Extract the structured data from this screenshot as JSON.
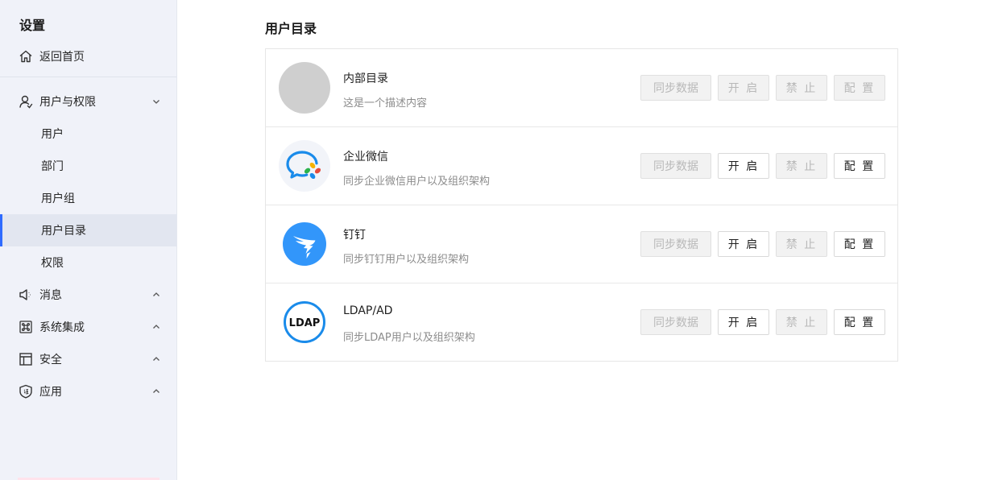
{
  "sidebar": {
    "title": "设置",
    "home": {
      "label": "返回首页",
      "icon": "home-icon"
    },
    "groups": [
      {
        "label": "用户与权限",
        "icon": "user-icon",
        "chevron": "chevron-down-icon",
        "children": [
          {
            "label": "用户"
          },
          {
            "label": "部门"
          },
          {
            "label": "用户组"
          },
          {
            "label": "用户目录",
            "active": true
          },
          {
            "label": "权限"
          }
        ]
      },
      {
        "label": "消息",
        "icon": "speaker-icon",
        "chevron": "chevron-up-icon"
      },
      {
        "label": "系统集成",
        "icon": "command-icon",
        "chevron": "chevron-up-icon"
      },
      {
        "label": "安全",
        "icon": "layout-icon",
        "chevron": "chevron-up-icon"
      },
      {
        "label": "应用",
        "icon": "shield-icon",
        "chevron": "chevron-up-icon"
      }
    ],
    "accent_color": "#2f6bff"
  },
  "main": {
    "title": "用户目录",
    "directories": [
      {
        "name": "内部目录",
        "desc": "这是一个描述内容",
        "logo": "placeholder-logo",
        "buttons": {
          "sync": "同步数据",
          "enable": "开 启",
          "disable": "禁 止",
          "config": "配 置"
        },
        "state": {
          "sync": "disabled",
          "enable": "disabled",
          "disable": "disabled",
          "config": "disabled"
        }
      },
      {
        "name": "企业微信",
        "desc": "同步企业微信用户以及组织架构",
        "logo": "wecom-logo",
        "buttons": {
          "sync": "同步数据",
          "enable": "开 启",
          "disable": "禁 止",
          "config": "配 置"
        },
        "state": {
          "sync": "disabled",
          "enable": "enabled",
          "disable": "disabled",
          "config": "enabled"
        }
      },
      {
        "name": "钉钉",
        "desc": "同步钉钉用户以及组织架构",
        "logo": "dingtalk-logo",
        "buttons": {
          "sync": "同步数据",
          "enable": "开 启",
          "disable": "禁 止",
          "config": "配 置"
        },
        "state": {
          "sync": "disabled",
          "enable": "enabled",
          "disable": "disabled",
          "config": "enabled"
        }
      },
      {
        "name": "LDAP/AD",
        "desc": "同步LDAP用户以及组织架构",
        "logo": "ldap-logo",
        "logo_text": "LDAP",
        "buttons": {
          "sync": "同步数据",
          "enable": "开 启",
          "disable": "禁 止",
          "config": "配 置"
        },
        "state": {
          "sync": "disabled",
          "enable": "enabled",
          "disable": "disabled",
          "config": "enabled"
        }
      }
    ]
  }
}
